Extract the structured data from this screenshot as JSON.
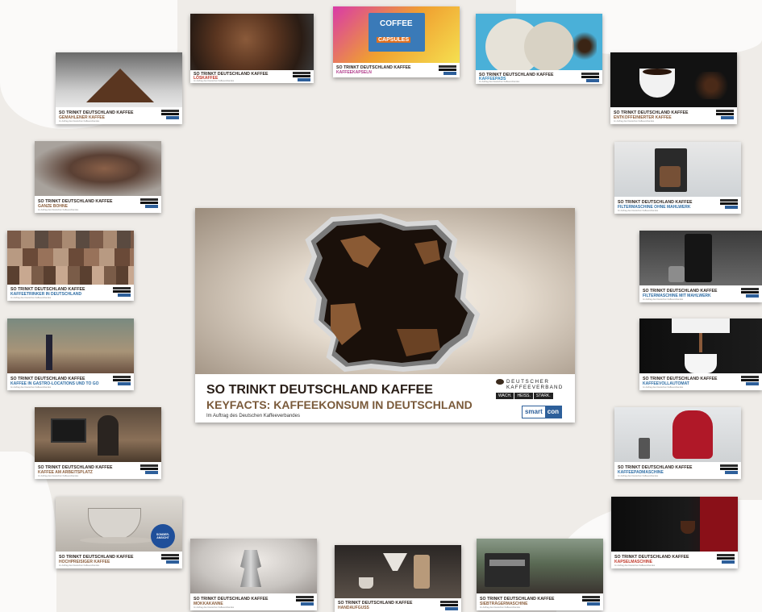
{
  "main": {
    "title": "SO TRINKT DEUTSCHLAND KAFFEE",
    "subtitle": "KEYFACTS: KAFFEEKONSUM IN DEUTSCHLAND",
    "commissioned": "Im Auftrag des Deutschen Kaffeeverbandes",
    "logo_line1": "DEUTSCHER",
    "logo_line2": "KAFFEEVERBAND",
    "slogan": [
      "WACH.",
      "HEISS.",
      "STARK."
    ],
    "partner_a": "smart",
    "partner_b": "con"
  },
  "cards": [
    {
      "title": "SO TRINKT DEUTSCHLAND KAFFEE",
      "sub": "LÖSKAFFEE",
      "sub_color": "#c0392b",
      "small": "Im Auftrag des Deutschen Kaffeeverbandes"
    },
    {
      "title": "SO TRINKT DEUTSCHLAND KAFFEE",
      "sub": "KAFFEEKAPSELN",
      "sub_color": "#b03a8a",
      "small": "Im Auftrag des Deutschen Kaffeeverbandes"
    },
    {
      "title": "SO TRINKT DEUTSCHLAND KAFFEE",
      "sub": "KAFFEEPADS",
      "sub_color": "#2980b9",
      "small": "Im Auftrag des Deutschen Kaffeeverbandes"
    },
    {
      "title": "SO TRINKT DEUTSCHLAND KAFFEE",
      "sub": "GEMAHLENER KAFFEE",
      "sub_color": "#8b5e3c",
      "small": "Im Auftrag des Deutschen Kaffeeverbandes"
    },
    {
      "title": "SO TRINKT DEUTSCHLAND KAFFEE",
      "sub": "ENTKOFFEINIERTER KAFFEE",
      "sub_color": "#8b5e3c",
      "small": "Im Auftrag des Deutschen Kaffeeverbandes"
    },
    {
      "title": "SO TRINKT DEUTSCHLAND KAFFEE",
      "sub": "GANZE BOHNE",
      "sub_color": "#8b5e3c",
      "small": "Im Auftrag des Deutschen Kaffeeverbandes"
    },
    {
      "title": "SO TRINKT DEUTSCHLAND KAFFEE",
      "sub": "FILTERMASCHINE OHNE MAHLWERK",
      "sub_color": "#2e6da4",
      "small": "Im Auftrag des Deutschen Kaffeeverbandes"
    },
    {
      "title": "SO TRINKT DEUTSCHLAND KAFFEE",
      "sub": "KAFFEETRINKER IN DEUTSCHLAND",
      "sub_color": "#2e6da4",
      "small": "Im Auftrag des Deutschen Kaffeeverbandes"
    },
    {
      "title": "SO TRINKT DEUTSCHLAND KAFFEE",
      "sub": "FILTERMASCHINE MIT MAHLWERK",
      "sub_color": "#2e6da4",
      "small": "Im Auftrag des Deutschen Kaffeeverbandes"
    },
    {
      "title": "SO TRINKT DEUTSCHLAND KAFFEE",
      "sub": "KAFFEE IN GASTRO-LOCATIONS UND TO GO",
      "sub_color": "#2e6da4",
      "small": "Im Auftrag des Deutschen Kaffeeverbandes"
    },
    {
      "title": "SO TRINKT DEUTSCHLAND KAFFEE",
      "sub": "KAFFEEVOLLAUTOMAT",
      "sub_color": "#2e6da4",
      "small": "Im Auftrag des Deutschen Kaffeeverbandes"
    },
    {
      "title": "SO TRINKT DEUTSCHLAND KAFFEE",
      "sub": "KAFFEE AM ARBEITSPLATZ",
      "sub_color": "#8b5e3c",
      "small": "Im Auftrag des Deutschen Kaffeeverbandes"
    },
    {
      "title": "SO TRINKT DEUTSCHLAND KAFFEE",
      "sub": "KAFFEEPADMASCHINE",
      "sub_color": "#2e6da4",
      "small": "Im Auftrag des Deutschen Kaffeeverbandes"
    },
    {
      "title": "SO TRINKT DEUTSCHLAND KAFFEE",
      "sub": "HOCHPREISIGER KAFFEE",
      "sub_color": "#8b5e3c",
      "small": "Im Auftrag des Deutschen Kaffeeverbandes",
      "badge": "SONDER-ANSICHT"
    },
    {
      "title": "SO TRINKT DEUTSCHLAND KAFFEE",
      "sub": "KAPSELMASCHINE",
      "sub_color": "#c0392b",
      "small": "Im Auftrag des Deutschen Kaffeeverbandes"
    },
    {
      "title": "SO TRINKT DEUTSCHLAND KAFFEE",
      "sub": "MOKKAKANNE",
      "sub_color": "#8b5e3c",
      "small": "Im Auftrag des Deutschen Kaffeeverbandes"
    },
    {
      "title": "SO TRINKT DEUTSCHLAND KAFFEE",
      "sub": "HANDAUFGUSS",
      "sub_color": "#8b5e3c",
      "small": "Im Auftrag des Deutschen Kaffeeverbandes"
    },
    {
      "title": "SO TRINKT DEUTSCHLAND KAFFEE",
      "sub": "SIEBTRÄGERMASCHINE",
      "sub_color": "#8b5e3c",
      "small": "Im Auftrag des Deutschen Kaffeeverbandes"
    }
  ],
  "capsule_art": {
    "brand": "COFFEE",
    "word": "CAPSULES"
  }
}
